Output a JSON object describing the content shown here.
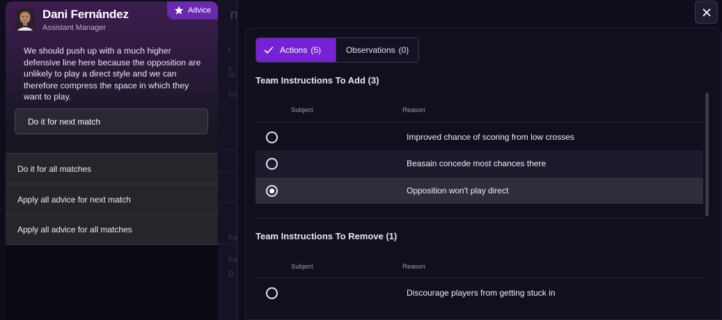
{
  "advisor": {
    "name": "Dani Fernández",
    "role": "Assistant Manager",
    "badge_label": "Advice",
    "message": "We should push up with a much higher defensive line here because the opposition are unlikely to play a direct style and we can therefore compress the space in which they want to play.",
    "primary_action": "Do it for next match",
    "options": [
      "Do it for all matches",
      "Apply all advice for next match",
      "Apply all advice for all matches"
    ]
  },
  "background": {
    "heading_fragment": "no",
    "fragments": [
      "t",
      "y",
      "re",
      "ho",
      "Fe",
      "Fa",
      "D"
    ]
  },
  "panel": {
    "tabs": [
      {
        "label": "Actions",
        "count": "(5)",
        "active": true
      },
      {
        "label": "Observations",
        "count": "(0)",
        "active": false
      }
    ],
    "add_section": {
      "title": "Team Instructions To Add (3)",
      "col_subject": "Subject",
      "col_reason": "Reason",
      "rows": [
        {
          "reason": "Improved chance of scoring from low crosses",
          "selected": false
        },
        {
          "reason": "Beasain concede most chances there",
          "selected": false
        },
        {
          "reason": "Opposition won't play direct",
          "selected": true
        }
      ]
    },
    "remove_section": {
      "title": "Team Instructions To Remove (1)",
      "col_subject": "Subject",
      "col_reason": "Reason",
      "rows": [
        {
          "reason": "Discourage players from getting stuck in",
          "selected": false
        }
      ]
    }
  },
  "colors": {
    "accent": "#7621d6",
    "badge": "#6a2ab0",
    "background": "#0f0d1c"
  },
  "icons": {
    "close": "close-icon",
    "check": "check-icon",
    "star": "star-icon"
  }
}
